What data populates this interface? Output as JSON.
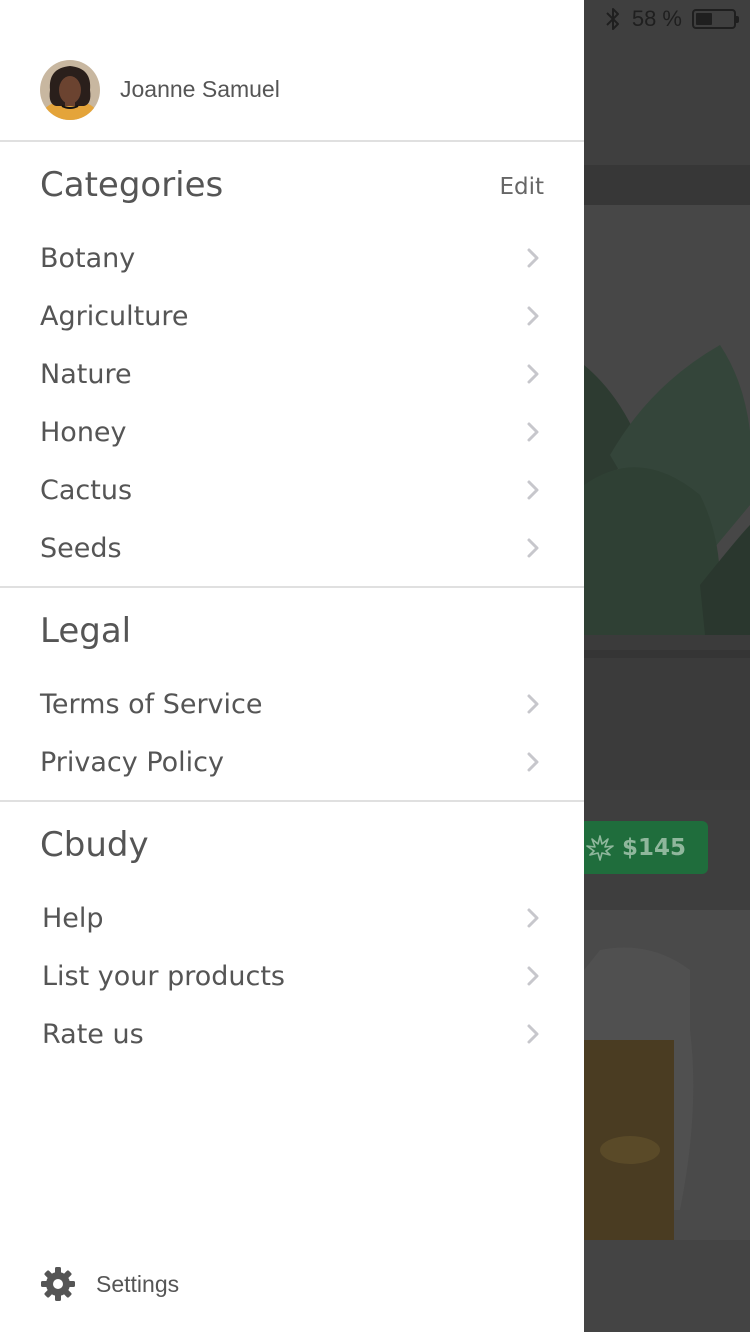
{
  "status_bar": {
    "battery_text": "58 %",
    "battery_level": 0.58
  },
  "background": {
    "price": "$145",
    "accent_color": "#1f6d3c"
  },
  "user": {
    "name": "Joanne Samuel"
  },
  "categories": {
    "title": "Categories",
    "edit_label": "Edit",
    "items": [
      {
        "label": "Botany"
      },
      {
        "label": "Agriculture"
      },
      {
        "label": "Nature"
      },
      {
        "label": "Honey"
      },
      {
        "label": "Cactus"
      },
      {
        "label": "Seeds"
      }
    ]
  },
  "legal": {
    "title": "Legal",
    "items": [
      {
        "label": "Terms of Service"
      },
      {
        "label": "Privacy Policy"
      }
    ]
  },
  "cbudy": {
    "title": "Cbudy",
    "items": [
      {
        "label": "Help"
      },
      {
        "label": "List your products"
      },
      {
        "label": "Rate us"
      }
    ]
  },
  "footer": {
    "settings_label": "Settings"
  },
  "icons": {
    "chevron": "chevron-right-icon",
    "settings": "gear-icon",
    "bluetooth": "bluetooth-icon",
    "battery": "battery-icon",
    "price": "leaf-icon"
  }
}
